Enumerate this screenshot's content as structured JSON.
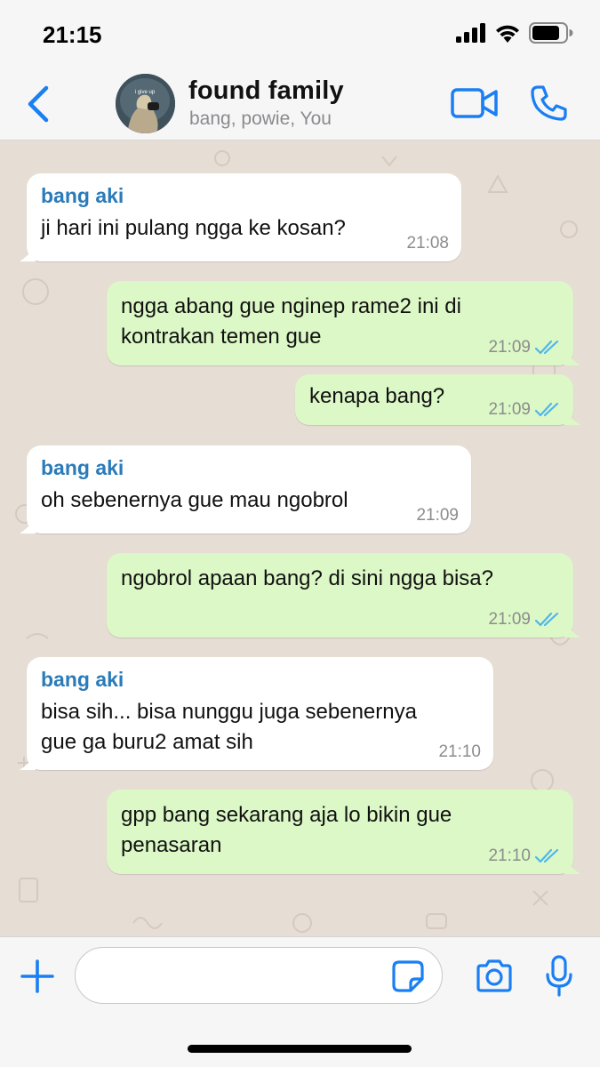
{
  "status_bar": {
    "time": "21:15",
    "icons": [
      "cellular-signal-icon",
      "wifi-icon",
      "battery-icon"
    ]
  },
  "header": {
    "title": "found family",
    "subtitle": "bang, powie, You",
    "avatar_text": "i give up",
    "icons": [
      "chevron-left-icon",
      "video-camera-icon",
      "phone-icon"
    ]
  },
  "colors": {
    "accent": "#1a7ff2",
    "sender_name": "#2b7bb9",
    "outgoing_bubble": "#dcf8c6",
    "incoming_bubble": "#ffffff",
    "chat_background": "#e6ddd4",
    "read_ticks": "#4fb6ec"
  },
  "messages": [
    {
      "direction": "in",
      "sender": "bang aki",
      "text": "ji hari ini pulang ngga ke kosan?",
      "time": "21:08"
    },
    {
      "direction": "out",
      "text": "ngga abang gue nginep rame2 ini di\nkontrakan temen gue",
      "time": "21:09",
      "status": "read"
    },
    {
      "direction": "out",
      "text": "kenapa bang?",
      "time": "21:09",
      "status": "read"
    },
    {
      "direction": "in",
      "sender": "bang aki",
      "text": "oh sebenernya gue mau ngobrol",
      "time": "21:09"
    },
    {
      "direction": "out",
      "text": "ngobrol apaan bang? di sini ngga bisa?",
      "time": "21:09",
      "status": "read"
    },
    {
      "direction": "in",
      "sender": "bang aki",
      "text": "bisa sih... bisa nunggu juga sebenernya\ngue ga buru2 amat sih",
      "time": "21:10"
    },
    {
      "direction": "out",
      "text": "gpp bang sekarang aja lo bikin gue\npenasaran",
      "time": "21:10",
      "status": "read"
    }
  ],
  "input_bar": {
    "value": "",
    "placeholder": "",
    "icons": [
      "plus-icon",
      "sticker-icon",
      "camera-icon",
      "microphone-icon"
    ]
  }
}
